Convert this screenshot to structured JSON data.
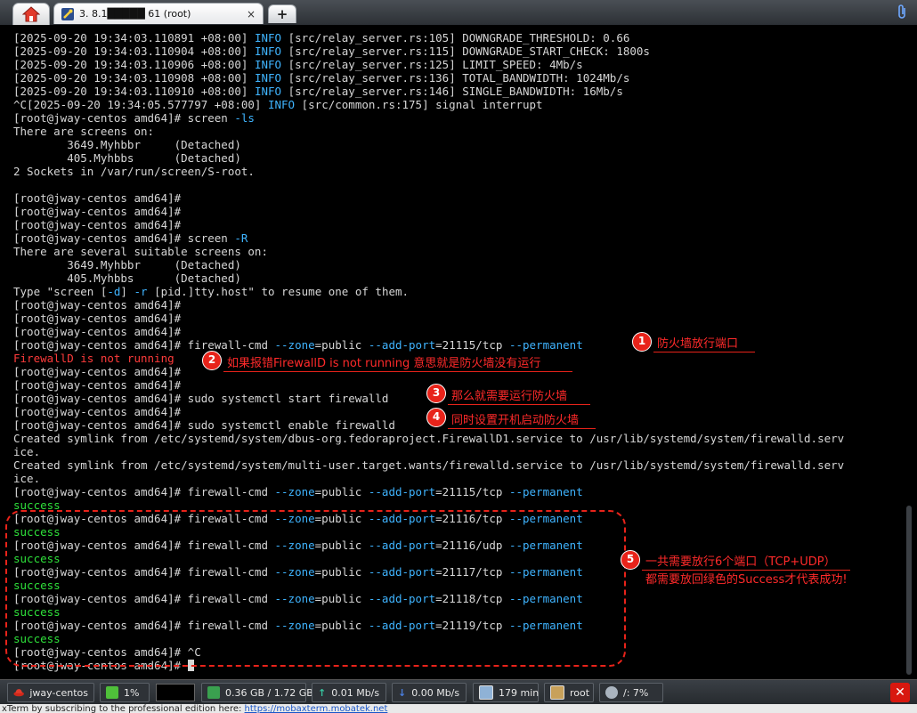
{
  "tabs": {
    "home_icon": "home-icon",
    "session_title": "3. 8.1█████ 61 (root)",
    "session_icon": "terminal-key-icon",
    "close": "×",
    "new_tab": "+",
    "attach_icon": "paperclip-icon"
  },
  "terminal": {
    "lines": [
      [
        {
          "t": "[2025-09-20 19:34:03.110891 +08:00] "
        },
        {
          "t": "INFO",
          "c": "cyan"
        },
        {
          "t": " [src/relay_server.rs:105] DOWNGRADE_THRESHOLD: 0.66"
        }
      ],
      [
        {
          "t": "[2025-09-20 19:34:03.110904 +08:00] "
        },
        {
          "t": "INFO",
          "c": "cyan"
        },
        {
          "t": " [src/relay_server.rs:115] DOWNGRADE_START_CHECK: 1800s"
        }
      ],
      [
        {
          "t": "[2025-09-20 19:34:03.110906 +08:00] "
        },
        {
          "t": "INFO",
          "c": "cyan"
        },
        {
          "t": " [src/relay_server.rs:125] LIMIT_SPEED: 4Mb/s"
        }
      ],
      [
        {
          "t": "[2025-09-20 19:34:03.110908 +08:00] "
        },
        {
          "t": "INFO",
          "c": "cyan"
        },
        {
          "t": " [src/relay_server.rs:136] TOTAL_BANDWIDTH: 1024Mb/s"
        }
      ],
      [
        {
          "t": "[2025-09-20 19:34:03.110910 +08:00] "
        },
        {
          "t": "INFO",
          "c": "cyan"
        },
        {
          "t": " [src/relay_server.rs:146] SINGLE_BANDWIDTH: 16Mb/s"
        }
      ],
      [
        {
          "t": "^C[2025-09-20 19:34:05.577797 +08:00] "
        },
        {
          "t": "INFO",
          "c": "cyan"
        },
        {
          "t": " [src/common.rs:175] signal interrupt"
        }
      ],
      [
        {
          "t": "[root@jway-centos amd64]# screen "
        },
        {
          "t": "-ls",
          "c": "cyan"
        }
      ],
      [
        {
          "t": "There are screens on:"
        }
      ],
      [
        {
          "t": "        3649.Myhbbr     (Detached)"
        }
      ],
      [
        {
          "t": "        405.Myhbbs      (Detached)"
        }
      ],
      [
        {
          "t": "2 Sockets in /var/run/screen/S-root."
        }
      ],
      [
        {
          "t": ""
        }
      ],
      [
        {
          "t": "[root@jway-centos amd64]#"
        }
      ],
      [
        {
          "t": "[root@jway-centos amd64]#"
        }
      ],
      [
        {
          "t": "[root@jway-centos amd64]#"
        }
      ],
      [
        {
          "t": "[root@jway-centos amd64]# screen "
        },
        {
          "t": "-R",
          "c": "cyan"
        }
      ],
      [
        {
          "t": "There are several suitable screens on:"
        }
      ],
      [
        {
          "t": "        3649.Myhbbr     (Detached)"
        }
      ],
      [
        {
          "t": "        405.Myhbbs      (Detached)"
        }
      ],
      [
        {
          "t": "Type \"screen ["
        },
        {
          "t": "-d",
          "c": "cyan"
        },
        {
          "t": "] "
        },
        {
          "t": "-r",
          "c": "cyan"
        },
        {
          "t": " [pid.]tty.host\" to resume one of them."
        }
      ],
      [
        {
          "t": "[root@jway-centos amd64]#"
        }
      ],
      [
        {
          "t": "[root@jway-centos amd64]#"
        }
      ],
      [
        {
          "t": "[root@jway-centos amd64]#"
        }
      ],
      [
        {
          "t": "[root@jway-centos amd64]# firewall-cmd "
        },
        {
          "t": "--zone",
          "c": "cyan"
        },
        {
          "t": "=public "
        },
        {
          "t": "--add-port",
          "c": "cyan"
        },
        {
          "t": "=21115/tcp "
        },
        {
          "t": "--permanent",
          "c": "cyan"
        }
      ],
      [
        {
          "t": "FirewallD is not running",
          "c": "red"
        }
      ],
      [
        {
          "t": "[root@jway-centos amd64]#"
        }
      ],
      [
        {
          "t": "[root@jway-centos amd64]#"
        }
      ],
      [
        {
          "t": "[root@jway-centos amd64]# sudo systemctl start firewalld"
        }
      ],
      [
        {
          "t": "[root@jway-centos amd64]#"
        }
      ],
      [
        {
          "t": "[root@jway-centos amd64]# sudo systemctl enable firewalld"
        }
      ],
      [
        {
          "t": "Created symlink from /etc/systemd/system/dbus-org.fedoraproject.FirewallD1.service to /usr/lib/systemd/system/firewalld.serv"
        }
      ],
      [
        {
          "t": "ice."
        }
      ],
      [
        {
          "t": "Created symlink from /etc/systemd/system/multi-user.target.wants/firewalld.service to /usr/lib/systemd/system/firewalld.serv"
        }
      ],
      [
        {
          "t": "ice."
        }
      ],
      [
        {
          "t": "[root@jway-centos amd64]# firewall-cmd "
        },
        {
          "t": "--zone",
          "c": "cyan"
        },
        {
          "t": "=public "
        },
        {
          "t": "--add-port",
          "c": "cyan"
        },
        {
          "t": "=21115/tcp "
        },
        {
          "t": "--permanent",
          "c": "cyan"
        }
      ],
      [
        {
          "t": "success",
          "c": "green"
        }
      ],
      [
        {
          "t": "[root@jway-centos amd64]# firewall-cmd "
        },
        {
          "t": "--zone",
          "c": "cyan"
        },
        {
          "t": "=public "
        },
        {
          "t": "--add-port",
          "c": "cyan"
        },
        {
          "t": "=21116/tcp "
        },
        {
          "t": "--permanent",
          "c": "cyan"
        }
      ],
      [
        {
          "t": "success",
          "c": "green"
        }
      ],
      [
        {
          "t": "[root@jway-centos amd64]# firewall-cmd "
        },
        {
          "t": "--zone",
          "c": "cyan"
        },
        {
          "t": "=public "
        },
        {
          "t": "--add-port",
          "c": "cyan"
        },
        {
          "t": "=21116/udp "
        },
        {
          "t": "--permanent",
          "c": "cyan"
        }
      ],
      [
        {
          "t": "success",
          "c": "green"
        }
      ],
      [
        {
          "t": "[root@jway-centos amd64]# firewall-cmd "
        },
        {
          "t": "--zone",
          "c": "cyan"
        },
        {
          "t": "=public "
        },
        {
          "t": "--add-port",
          "c": "cyan"
        },
        {
          "t": "=21117/tcp "
        },
        {
          "t": "--permanent",
          "c": "cyan"
        }
      ],
      [
        {
          "t": "success",
          "c": "green"
        }
      ],
      [
        {
          "t": "[root@jway-centos amd64]# firewall-cmd "
        },
        {
          "t": "--zone",
          "c": "cyan"
        },
        {
          "t": "=public "
        },
        {
          "t": "--add-port",
          "c": "cyan"
        },
        {
          "t": "=21118/tcp "
        },
        {
          "t": "--permanent",
          "c": "cyan"
        }
      ],
      [
        {
          "t": "success",
          "c": "green"
        }
      ],
      [
        {
          "t": "[root@jway-centos amd64]# firewall-cmd "
        },
        {
          "t": "--zone",
          "c": "cyan"
        },
        {
          "t": "=public "
        },
        {
          "t": "--add-port",
          "c": "cyan"
        },
        {
          "t": "=21119/tcp "
        },
        {
          "t": "--permanent",
          "c": "cyan"
        }
      ],
      [
        {
          "t": "success",
          "c": "green"
        }
      ],
      [
        {
          "t": "[root@jway-centos amd64]# ^C"
        }
      ],
      [
        {
          "t": "[root@jway-centos amd64]# "
        },
        {
          "t": "",
          "cursor": true
        }
      ]
    ]
  },
  "annotations": [
    {
      "num": "1",
      "text": "防火墙放行端口"
    },
    {
      "num": "2",
      "text": "如果报错FirewallD is not running 意思就是防火墙没有运行"
    },
    {
      "num": "3",
      "text": "那么就需要运行防火墙"
    },
    {
      "num": "4",
      "text": "同时设置开机启动防火墙"
    },
    {
      "num": "5",
      "text_line1": "一共需要放行6个端口（TCP+UDP）",
      "text_line2": "都需要放回绿色的Success才代表成功!"
    }
  ],
  "statusbar": {
    "host": "jway-centos",
    "cpu": "1%",
    "memory": "0.36 GB / 1.72 GB",
    "upload": "0.01 Mb/s",
    "download": "0.00 Mb/s",
    "uptime": "179 min",
    "user": "root",
    "disk": "/: 7%"
  },
  "footer": {
    "text": "xTerm by subscribing to the professional edition here:  ",
    "link": "https://mobaxterm.mobatek.net"
  },
  "colors": {
    "info_cyan": "#3fb4ff",
    "error_red": "#ff3b3b",
    "success_green": "#2ee03a",
    "annotation_red": "#e8231a"
  }
}
